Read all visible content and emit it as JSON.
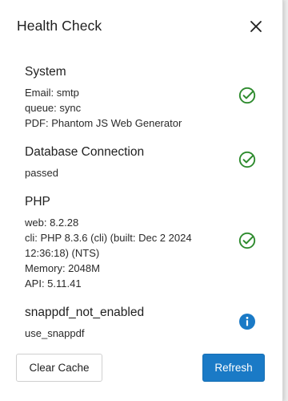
{
  "modal": {
    "title": "Health Check"
  },
  "sections": {
    "system": {
      "title": "System",
      "lines": [
        "Email: smtp",
        "queue: sync",
        "PDF: Phantom JS Web Generator"
      ],
      "status": "check"
    },
    "database": {
      "title": "Database Connection",
      "lines": [
        "passed"
      ],
      "status": "check"
    },
    "php": {
      "title": "PHP",
      "lines": [
        "web: 8.2.28",
        "cli: PHP 8.3.6 (cli) (built: Dec 2 2024",
        "12:36:18) (NTS)",
        "Memory: 2048M",
        "API: 5.11.41"
      ],
      "status": "check"
    },
    "snappdf": {
      "title": "snappdf_not_enabled",
      "lines": [
        "use_snappdf"
      ],
      "status": "info"
    }
  },
  "footer": {
    "clear_cache_label": "Clear Cache",
    "refresh_label": "Refresh"
  },
  "colors": {
    "success": "#2e8b2e",
    "info": "#1a7ac6",
    "primary_button": "#1a7ac6"
  },
  "icons": {
    "close": "close-icon",
    "check": "check-circle-icon",
    "info": "info-icon"
  }
}
